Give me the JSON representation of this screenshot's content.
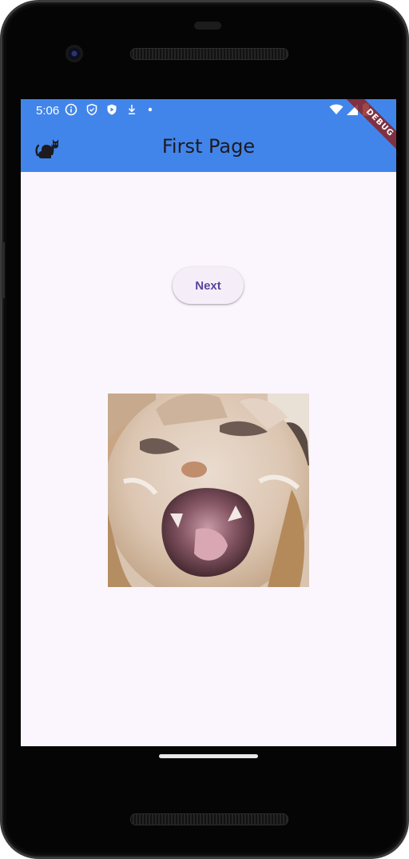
{
  "status_bar": {
    "time": "5:06",
    "left_icons": [
      "info-icon",
      "shield-icon",
      "play-protect-icon",
      "download-icon",
      "dot-icon"
    ],
    "right_icons": [
      "wifi-icon",
      "cellular-icon",
      "battery-icon"
    ],
    "color": "#4285ea"
  },
  "app_bar": {
    "title": "First Page",
    "logo": "cat-icon",
    "background": "#4285ea"
  },
  "debug_banner": "DEBUG",
  "main": {
    "next_button_label": "Next",
    "image": "cat-photo"
  },
  "colors": {
    "screen_background": "#fbf6fd",
    "button_text": "#5a43a1"
  }
}
